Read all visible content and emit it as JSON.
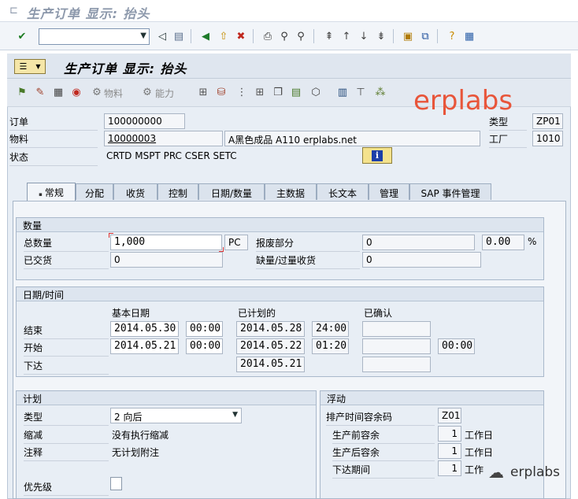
{
  "window": {
    "title": "生产订单 显示: 抬头"
  },
  "toolbar": {
    "command_field": "",
    "icons": [
      "enter-icon",
      "back-icon",
      "save-icon",
      "back-nav-icon",
      "exit-icon",
      "cancel-icon",
      "print-icon",
      "find-icon",
      "find-next-icon",
      "first-page-icon",
      "prev-page-icon",
      "next-page-icon",
      "last-page-icon",
      "create-session-icon",
      "shortcut-icon",
      "help-icon",
      "layout-icon"
    ]
  },
  "header": {
    "title": "生产订单 显示: 抬头",
    "app_toolbar": {
      "material_label": "物料",
      "capacity_label": "能力"
    }
  },
  "watermark": {
    "text": "erplabs",
    "footer_text": "erplabs"
  },
  "order": {
    "order_label": "订单",
    "order_value": "100000000",
    "material_label": "物料",
    "material_value": "10000003",
    "material_desc": "A黑色成品 A110 erplabs.net",
    "status_label": "状态",
    "status_value": "CRTD MSPT PRC  CSER SETC",
    "type_label": "类型",
    "type_value": "ZP01",
    "plant_label": "工厂",
    "plant_value": "1010"
  },
  "tabs": [
    "常规",
    "分配",
    "收货",
    "控制",
    "日期/数量",
    "主数据",
    "长文本",
    "管理",
    "SAP 事件管理"
  ],
  "active_tab": "常规",
  "quantity": {
    "title": "数量",
    "total_label": "总数量",
    "total_value": "1,000",
    "unit": "PC",
    "scrap_label": "报废部分",
    "scrap_value": "0",
    "scrap_pct": "0.00",
    "pct_sign": "%",
    "delivered_label": "已交货",
    "delivered_value": "0",
    "short_label": "缺量/过量收货",
    "short_value": "0"
  },
  "dates": {
    "title": "日期/时间",
    "col_basic": "基本日期",
    "col_scheduled": "已计划的",
    "col_confirmed": "已确认",
    "end_label": "结束",
    "end_basic_date": "2014.05.30",
    "end_basic_time": "00:00",
    "end_sched_date": "2014.05.28",
    "end_sched_time": "24:00",
    "start_label": "开始",
    "start_basic_date": "2014.05.21",
    "start_basic_time": "00:00",
    "start_sched_date": "2014.05.22",
    "start_sched_time": "01:20",
    "start_conf_time": "00:00",
    "release_label": "下达",
    "release_sched_date": "2014.05.21"
  },
  "planning": {
    "title": "计划",
    "type_label": "类型",
    "type_value": "2 向后",
    "reduction_label": "缩减",
    "reduction_value": "没有执行缩减",
    "note_label": "注释",
    "note_value": "无计划附注",
    "priority_label": "优先级"
  },
  "float": {
    "title": "浮动",
    "key_label": "排产时间容余码",
    "key_value": "Z01",
    "before_label": "生产前容余",
    "before_value": "1",
    "before_unit": "工作日",
    "after_label": "生产后容余",
    "after_value": "1",
    "after_unit": "工作日",
    "release_label": "下达期间",
    "release_value": "1",
    "release_unit": "工作"
  },
  "colors": {
    "accent": "#e8553a",
    "panel": "#e8eef5",
    "border": "#a9b8cb"
  }
}
